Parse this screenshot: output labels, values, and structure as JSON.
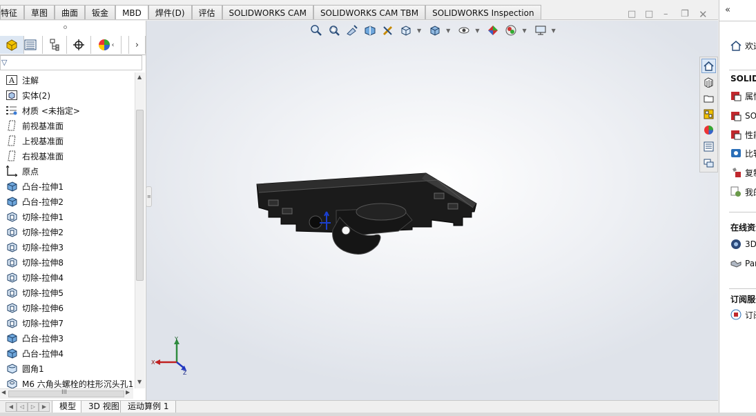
{
  "command_tabs": [
    "特征",
    "草图",
    "曲面",
    "钣金",
    "MBD",
    "焊件(D)",
    "评估",
    "SOLIDWORKS CAM",
    "SOLIDWORKS CAM TBM",
    "SOLIDWORKS Inspection"
  ],
  "active_command_tab": "MBD",
  "feature_tree": [
    {
      "label": "注解",
      "icon": "annotation-icon"
    },
    {
      "label": "实体(2)",
      "icon": "solid-bodies-icon"
    },
    {
      "label": "材质 <未指定>",
      "icon": "material-icon"
    },
    {
      "label": "前视基准面",
      "icon": "plane-icon"
    },
    {
      "label": "上视基准面",
      "icon": "plane-icon"
    },
    {
      "label": "右视基准面",
      "icon": "plane-icon"
    },
    {
      "label": "原点",
      "icon": "origin-icon"
    },
    {
      "label": "凸台-拉伸1",
      "icon": "boss-extrude-icon"
    },
    {
      "label": "凸台-拉伸2",
      "icon": "boss-extrude-icon"
    },
    {
      "label": "切除-拉伸1",
      "icon": "cut-extrude-icon"
    },
    {
      "label": "切除-拉伸2",
      "icon": "cut-extrude-icon"
    },
    {
      "label": "切除-拉伸3",
      "icon": "cut-extrude-icon"
    },
    {
      "label": "切除-拉伸8",
      "icon": "cut-extrude-icon"
    },
    {
      "label": "切除-拉伸4",
      "icon": "cut-extrude-icon"
    },
    {
      "label": "切除-拉伸5",
      "icon": "cut-extrude-icon"
    },
    {
      "label": "切除-拉伸6",
      "icon": "cut-extrude-icon"
    },
    {
      "label": "切除-拉伸7",
      "icon": "cut-extrude-icon"
    },
    {
      "label": "凸台-拉伸3",
      "icon": "boss-extrude-icon"
    },
    {
      "label": "凸台-拉伸4",
      "icon": "boss-extrude-icon"
    },
    {
      "label": "圆角1",
      "icon": "fillet-icon"
    },
    {
      "label": "M6 六角头螺栓的柱形沉头孔1",
      "icon": "hole-wizard-icon"
    }
  ],
  "bottom_tabs": [
    "模型",
    "3D 视图",
    "运动算例 1"
  ],
  "active_bottom_tab": "模型",
  "hscroll_label": "III",
  "triad": {
    "x": "X",
    "y": "Y",
    "z": "Z"
  },
  "task_pane": {
    "welcome_item": "欢迎",
    "section1_header": "SOLIDWORKS",
    "section1_items": [
      "属性",
      "SOLIDWORKS",
      "性能",
      "比较",
      "复制",
      "我的"
    ],
    "section2_header": "在线资源",
    "section2_items": [
      "3D",
      "Partner"
    ],
    "section3_header": "订阅服务",
    "section3_items": [
      "订阅"
    ]
  },
  "colors": {
    "accent": "#7ba0cf",
    "viewport_bg": "#eef0f4",
    "model": "#1b1b1b"
  }
}
